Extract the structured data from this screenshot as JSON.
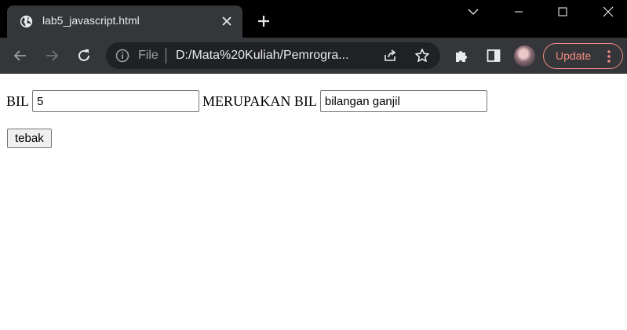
{
  "browser": {
    "tab": {
      "title": "lab5_javascript.html",
      "favicon": "globe-icon"
    },
    "omnibox": {
      "scheme_label": "File",
      "url": "D:/Mata%20Kuliah/Pemrogra..."
    },
    "update_label": "Update",
    "colors": {
      "tabstrip": "#000000",
      "toolbar": "#35363a",
      "omnibox": "#202124",
      "update_accent": "#f28b82"
    }
  },
  "page": {
    "bil_label": "BIL",
    "bil_value": "5",
    "result_label": "MERUPAKAN BIL",
    "result_value": "bilangan ganjil",
    "button_label": "tebak"
  }
}
